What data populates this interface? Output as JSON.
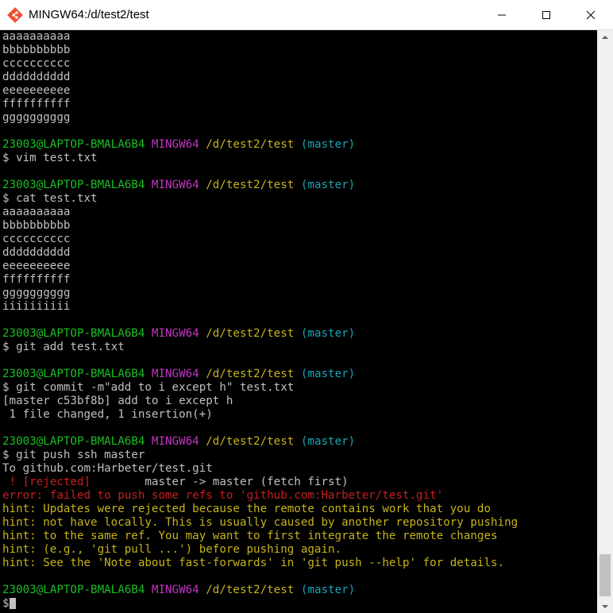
{
  "window": {
    "title": "MINGW64:/d/test2/test",
    "controls": [
      "minimize",
      "maximize",
      "close"
    ],
    "icon": "git-bash-icon"
  },
  "prompt": {
    "user": "23003@LAPTOP-BMALA6B4",
    "msystem": "MINGW64",
    "path": "/d/test2/test",
    "branch": "(master)"
  },
  "colors": {
    "user": "#1bbd24",
    "msystem": "#c238c2",
    "path": "#c6b31b",
    "branch": "#19a4b3",
    "error": "#c81e1e",
    "hint": "#c6b31b",
    "text": "#c0c0c0",
    "background": "#000000"
  },
  "terminal": {
    "head_output": [
      "aaaaaaaaaa",
      "bbbbbbbbbb",
      "cccccccccc",
      "dddddddddd",
      "eeeeeeeeee",
      "ffffffffff",
      "gggggggggg"
    ],
    "cmd_vim": "$ vim test.txt",
    "cmd_cat": "$ cat test.txt",
    "cat_output": [
      "aaaaaaaaaa",
      "bbbbbbbbbb",
      "cccccccccc",
      "dddddddddd",
      "eeeeeeeeee",
      "ffffffffff",
      "gggggggggg",
      "iiiiiiiiii"
    ],
    "cmd_add": "$ git add test.txt",
    "cmd_commit": "$ git commit -m\"add to i except h\" test.txt",
    "commit_output": [
      "[master c53bf8b] add to i except h",
      " 1 file changed, 1 insertion(+)"
    ],
    "cmd_push": "$ git push ssh master",
    "push_to": "To github.com:Harbeter/test.git",
    "rejected_mark": " ! [rejected]",
    "rejected_rest": "        master -> master (fetch first)",
    "error_line": "error: failed to push some refs to 'github.com:Harbeter/test.git'",
    "hints": [
      "hint: Updates were rejected because the remote contains work that you do",
      "hint: not have locally. This is usually caused by another repository pushing",
      "hint: to the same ref. You may want to first integrate the remote changes",
      "hint: (e.g., 'git pull ...') before pushing again.",
      "hint: See the 'Note about fast-forwards' in 'git push --help' for details."
    ],
    "final_prompt_symbol": "$"
  }
}
